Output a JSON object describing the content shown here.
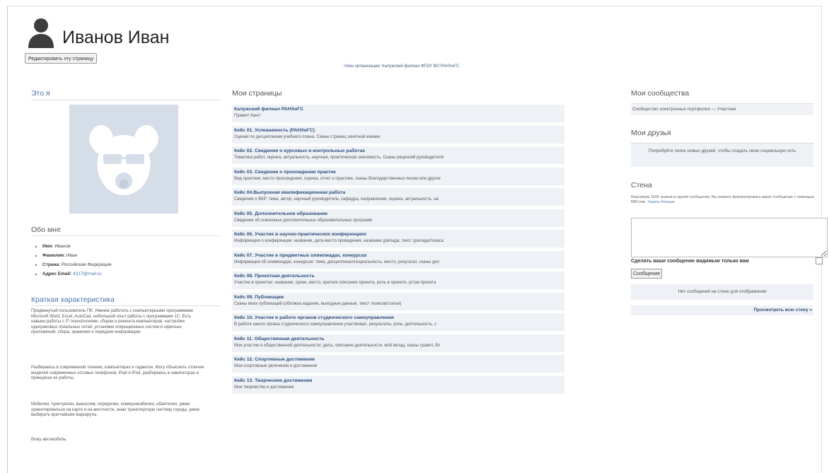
{
  "header": {
    "username": "Иванов Иван",
    "edit_button": "Редактировать эту страницу",
    "org_link": "Член организации: Калужский филиал ФГОУ ВО РАНХиГС"
  },
  "left": {
    "title": "Это я",
    "about_title": "Обо мне",
    "about": [
      {
        "label": "Имя:",
        "value": "Иванов"
      },
      {
        "label": "Фамилия:",
        "value": "Иван"
      },
      {
        "label": "Страна:",
        "value": "Российская Федерация"
      },
      {
        "label": "Адрес Email:",
        "value": "4217@mail.ru"
      }
    ],
    "char_title": "Краткая характеристика",
    "paragraphs": [
      "Продвинутый пользователь ПК. Умение работать с компьютерными программами Microsoft Word, Excel, AutoCad, небольшой опыт работы с программами 1С. Есть навыки работы с IT-технологиями, сборки и ремонта компьютеров, настройки однорановых локальных сетей, установки операционных систем и офисных приложений, сбора, хранения и передачи информации.",
      "Разбираюсь в современной технике, компьютерах и гаджетах. Могу объяснить отличия моделей современных сотовых телефонов, iPad и iPod, разбираюсь в навигаторах и принципах их работы.",
      "Мобилен, пунктуален, вынослив, порядочен, коммуникабелен, обаятелен, умею ориентироваться на карте и на местности, знаю транспортную систему города, умею выбирать кратчайшие маршруты.",
      "Вожу автомобиль."
    ]
  },
  "middle": {
    "title": "Мои страницы",
    "pages": [
      {
        "title": "Калужский филиал РАНХиГС",
        "desc": "Привет! Кенг!"
      },
      {
        "title": "Кейс 01. Успеваемость (РАНХиГС)",
        "desc": "Оценки по дисциплинам учебного плана. Сканы страниц зачетной книжки"
      },
      {
        "title": "Кейс 02. Сведения о курсовых и контрольных работах",
        "desc": "Тематика работ, оценка, актуальность, научная, практическая значимость. Сканы рецензий руководителя"
      },
      {
        "title": "Кейс 03. Сведения о прохождении практик",
        "desc": "Вид практики, место прохождения, оценка, отчет о практике, сканы благодарственных писем или других"
      },
      {
        "title": "Кейс 04.Выпускная квалификационная работа",
        "desc": "Сведения о ВКР: тема, автор, научный руководитель, кафедра, направление, оценка, актуальность, на"
      },
      {
        "title": "Кейс 05. Дополнительное образование",
        "desc": "Сведения об освоенных дополнительных образовательных программ"
      },
      {
        "title": "Кейс 06. Участие в научно-практических конференциях",
        "desc": "Информация о конференции: название, дата-место проведения, название доклада, текст доклада/тезиса"
      },
      {
        "title": "Кейс 07. Участие в предметных олимпиадах, конкурсах",
        "desc": "Информация об олимпиадах, конкурсах: тема, дисциплина/специальность, место, результат, сканы дип"
      },
      {
        "title": "Кейс 08. Проектная деятельность",
        "desc": "Участие в проектах: название, сроки, место, краткое описание проекта, роль в проекте, устав проекта"
      },
      {
        "title": "Кейс 09. Публикации",
        "desc": "Сканы моих публикаций (обложка издания, выходные данные, текст тезисов/статьи)"
      },
      {
        "title": "Кейс 10. Участие в работе органов студенческого самоуправления",
        "desc": "В работе какого органа студенческого самоуправления участвовал, результаты, роль, деятельность, с"
      },
      {
        "title": "Кейс 11. Общественная деятельность",
        "desc": "Мое участие в общественной деятельности: даты, описание деятельности, мой вклад, сканы грамот, бл"
      },
      {
        "title": "Кейс 12. Спортивные достижения",
        "desc": "Мои спортивные увлечения и достижения"
      },
      {
        "title": "Кейс 13. Творческие достижения",
        "desc": "Мое творчество и достижения"
      }
    ]
  },
  "right": {
    "communities_title": "Мои сообщества",
    "community": "Сообщество электронных портфолио — Участник",
    "friends_title": "Мои друзья",
    "friends_text": "Попробуйте поиск новых друзей, чтобы создать свою социальную сеть",
    "wall_title": "Стена",
    "wall_note": "Максимум 1500 знаков в одном сообщении. Вы можете форматировать ваше сообщение с помощью BBCode.",
    "wall_more": "Узнать больше",
    "private_label": "Сделать ваше сообщение видимым только вам",
    "post_button": "Сообщение",
    "no_posts": "Нет сообщений на стене для отображения",
    "view_wall": "Просмотреть всю стену »"
  }
}
